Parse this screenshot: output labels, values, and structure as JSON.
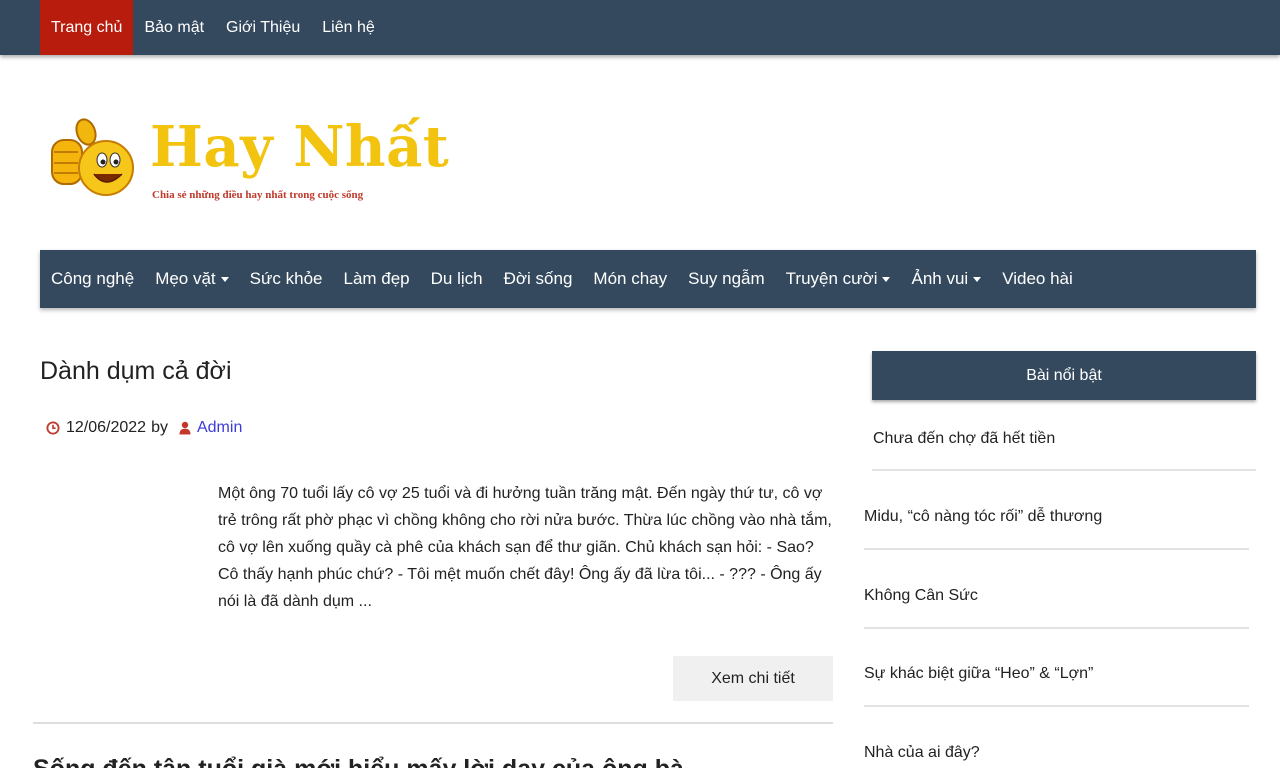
{
  "topnav": {
    "items": [
      {
        "label": "Trang chủ",
        "active": true
      },
      {
        "label": "Bảo mật",
        "active": false
      },
      {
        "label": "Giới Thiệu",
        "active": false
      },
      {
        "label": "Liên hệ",
        "active": false
      }
    ]
  },
  "logo": {
    "title": "Hay Nhất",
    "tagline": "Chia sẻ những điều hay nhất trong cuộc sống",
    "icon": "thumbs-up-smiley-icon"
  },
  "mainnav": {
    "items": [
      {
        "label": "Công nghệ",
        "dropdown": false
      },
      {
        "label": "Mẹo vặt",
        "dropdown": true
      },
      {
        "label": "Sức khỏe",
        "dropdown": false
      },
      {
        "label": "Làm đẹp",
        "dropdown": false
      },
      {
        "label": "Du lịch",
        "dropdown": false
      },
      {
        "label": "Đời sống",
        "dropdown": false
      },
      {
        "label": "Món chay",
        "dropdown": false
      },
      {
        "label": "Suy ngẫm",
        "dropdown": false
      },
      {
        "label": "Truyện cười",
        "dropdown": true
      },
      {
        "label": "Ảnh vui",
        "dropdown": true
      },
      {
        "label": "Video hài",
        "dropdown": false
      }
    ]
  },
  "post": {
    "title": "Dành dụm cả đời",
    "date": "12/06/2022",
    "by": "by",
    "author": "Admin",
    "excerpt": "Một ông 70 tuổi lấy cô vợ 25 tuổi và đi hưởng tuần trăng mật. Đến ngày thứ tư, cô vợ trẻ trông rất phờ phạc vì chồng không cho rời nửa bước. Thừa lúc chồng vào nhà tắm, cô vợ lên xuống quầy cà phê của khách sạn để thư giãn. Chủ khách sạn hỏi: - Sao? Cô thấy hạnh phúc chứ? - Tôi mệt muốn chết đây! Ông ấy đã lừa tôi... - ??? - Ông ấy nói là đã dành dụm ...",
    "readmore": "Xem chi tiết",
    "next_title": "Sống đến tận tuổi già mới hiểu mấy lời dạy của ông bà"
  },
  "sidebar": {
    "heading": "Bài nổi bật",
    "items": [
      "Chưa đến chợ đã hết tiền",
      "Midu, “cô nàng tóc rối” dễ thương",
      "Không Cân Sức",
      "Sự khác biệt giữa “Heo” & “Lợn”",
      "Nhà của ai đây?"
    ]
  },
  "colors": {
    "nav_bg": "#34495e",
    "active_bg": "#b71c0c",
    "logo_yellow": "#f2c30f",
    "author_link": "#3b3bd6",
    "icon_red": "#c0392b"
  }
}
